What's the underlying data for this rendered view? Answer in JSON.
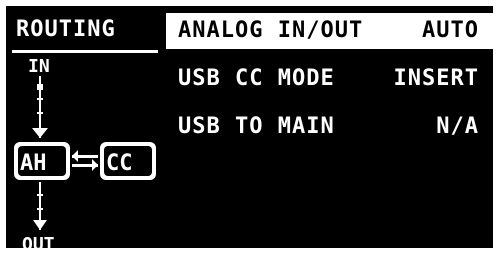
{
  "sidebar": {
    "title": "ROUTING",
    "diagram": {
      "top_label": "IN",
      "bottom_label": "OUT",
      "left_node": "AH",
      "right_node": "CC"
    }
  },
  "settings": [
    {
      "label": "ANALOG IN/OUT",
      "value": "AUTO",
      "selected": true
    },
    {
      "label": "USB CC MODE",
      "value": "INSERT",
      "selected": false
    },
    {
      "label": "USB TO MAIN",
      "value": "N/A",
      "selected": false
    }
  ],
  "colors": {
    "background": "#000000",
    "foreground": "#ffffff",
    "frame": "#ffffff"
  }
}
